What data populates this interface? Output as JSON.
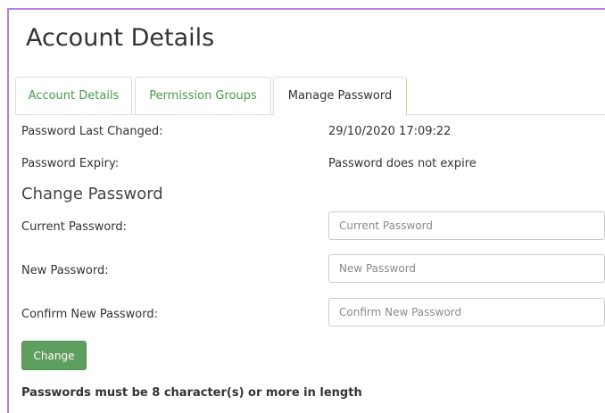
{
  "page": {
    "title": "Account Details"
  },
  "tabs": [
    {
      "label": "Account Details",
      "active": false
    },
    {
      "label": "Permission Groups",
      "active": false
    },
    {
      "label": "Manage Password",
      "active": true
    }
  ],
  "info": {
    "last_changed_label": "Password Last Changed:",
    "last_changed_value": "29/10/2020 17:09:22",
    "expiry_label": "Password Expiry:",
    "expiry_value": "Password does not expire"
  },
  "change": {
    "heading": "Change Password",
    "current_label": "Current Password:",
    "current_placeholder": "Current Password",
    "current_value": "",
    "new_label": "New Password:",
    "new_placeholder": "New Password",
    "new_value": "",
    "confirm_label": "Confirm New Password:",
    "confirm_placeholder": "Confirm New Password",
    "confirm_value": "",
    "button_label": "Change",
    "note": "Passwords must be 8 character(s) or more in length"
  },
  "colors": {
    "accent_border": "#b77de0",
    "tab_link": "#4a9a4a",
    "button": "#5e9e5e"
  }
}
